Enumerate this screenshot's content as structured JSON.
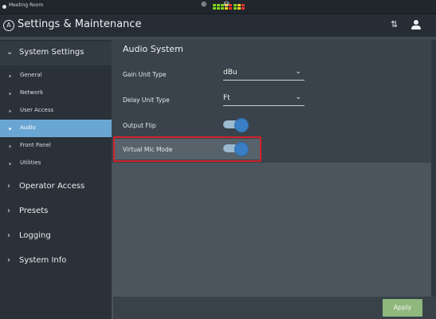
{
  "status_bar": {
    "room_name": "Meeting Room",
    "input_icon": "⊕",
    "output_icon": "⊖",
    "meter_colors": {
      "green": "#7ed321",
      "yellow": "#f1d21c",
      "red": "#e4332a"
    }
  },
  "title_bar": {
    "logo_glyph": "A",
    "title": "Settings & Maintenance",
    "sort_icon": "⇅",
    "user_icon": "user-icon"
  },
  "sidebar": {
    "system_settings": {
      "label": "System Settings",
      "expanded_icon": "⌄",
      "items": [
        {
          "label": "General"
        },
        {
          "label": "Network"
        },
        {
          "label": "User Access"
        },
        {
          "label": "Audio",
          "active": true
        },
        {
          "label": "Front Panel"
        },
        {
          "label": "Utilities"
        }
      ]
    },
    "collapsed_icon": "›",
    "sections": [
      {
        "label": "Operator Access"
      },
      {
        "label": "Presets"
      },
      {
        "label": "Logging"
      },
      {
        "label": "System Info"
      }
    ]
  },
  "main": {
    "title": "Audio System",
    "gain_unit": {
      "label": "Gain Unit Type",
      "value": "dBu",
      "arrow": "⌄"
    },
    "delay_unit": {
      "label": "Delay Unit Type",
      "value": "Ft",
      "arrow": "⌄"
    },
    "output_flip": {
      "label": "Output Flip",
      "on": true
    },
    "virtual_mic": {
      "label": "Virtual Mic Mode",
      "on": true
    }
  },
  "footer": {
    "apply_label": "Apply"
  },
  "colors": {
    "accent": "#6aa6d3",
    "toggle_on": "#3a7fc4",
    "apply": "#8fb77e",
    "highlight_border": "#d0232a"
  }
}
